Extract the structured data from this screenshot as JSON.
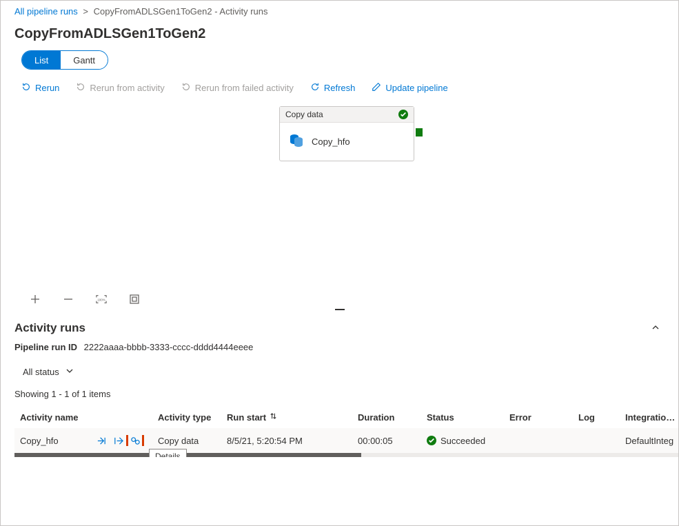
{
  "breadcrumb": {
    "root": "All pipeline runs",
    "current": "CopyFromADLSGen1ToGen2 - Activity runs"
  },
  "page_title": "CopyFromADLSGen1ToGen2",
  "view_toggle": {
    "list": "List",
    "gantt": "Gantt"
  },
  "toolbar": {
    "rerun": "Rerun",
    "rerun_from_activity": "Rerun from activity",
    "rerun_from_failed": "Rerun from failed activity",
    "refresh": "Refresh",
    "update_pipeline": "Update pipeline"
  },
  "canvas_activity": {
    "header": "Copy data",
    "name": "Copy_hfo"
  },
  "canvas_controls": {
    "zoom_100": "100%"
  },
  "activity_runs": {
    "title": "Activity runs",
    "run_id_label": "Pipeline run ID",
    "run_id": "2222aaaa-bbbb-3333-cccc-dddd4444eeee",
    "status_filter": "All status",
    "showing": "Showing 1 - 1 of 1 items",
    "headers": {
      "name": "Activity name",
      "type": "Activity type",
      "start": "Run start",
      "duration": "Duration",
      "status": "Status",
      "error": "Error",
      "log": "Log",
      "integration": "Integration r"
    },
    "row": {
      "name": "Copy_hfo",
      "type": "Copy data",
      "start": "8/5/21, 5:20:54 PM",
      "duration": "00:00:05",
      "status": "Succeeded",
      "integration": "DefaultInteg"
    },
    "tooltip_details": "Details"
  }
}
